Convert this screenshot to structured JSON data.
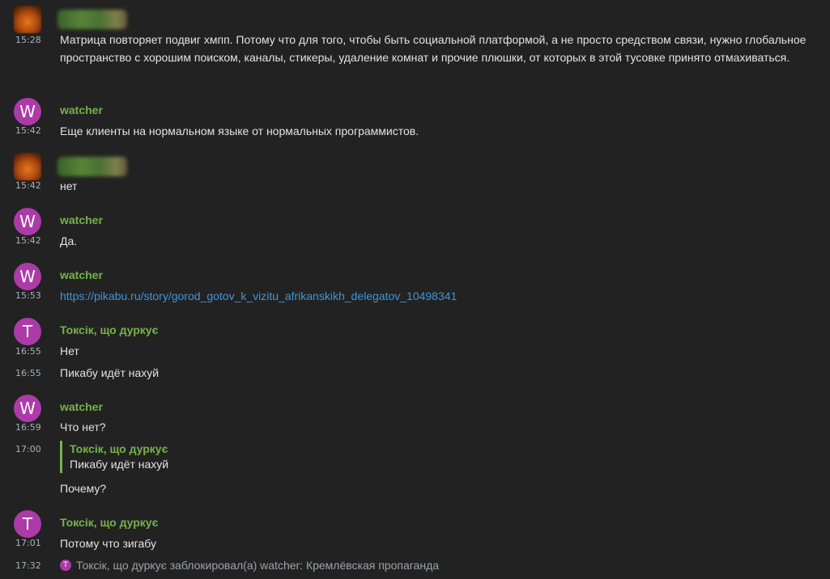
{
  "colors": {
    "background": "#222222",
    "sender_name": "#76b24a",
    "avatar_purple": "#ac3ba8",
    "link": "#3f96d8",
    "text": "#e3e3e3",
    "timestamp": "#a9b1bb"
  },
  "messages": [
    {
      "sender": "",
      "avatar": "blurred-photo",
      "time": "15:28",
      "text": "Матрица повторяет подвиг хмпп. Потому что для того, чтобы быть социальной платформой, а не просто средством связи, нужно глобальное пространство с хорошим поиском, каналы, стикеры, удаление комнат и прочие плюшки, от которых в этой тусовке принято отмахиваться."
    },
    {
      "sender": "watcher",
      "avatar_letter": "W",
      "time": "15:42",
      "text": "Еще клиенты на нормальном языке от нормальных  программистов."
    },
    {
      "sender": "",
      "avatar": "blurred-photo",
      "time": "15:42",
      "text": "нет"
    },
    {
      "sender": "watcher",
      "avatar_letter": "W",
      "time": "15:42",
      "text": "Да."
    },
    {
      "sender": "watcher",
      "avatar_letter": "W",
      "time": "15:53",
      "link": "https://pikabu.ru/story/gorod_gotov_k_vizitu_afrikanskikh_delegatov_10498341"
    },
    {
      "sender": "Токсік, що дуркує",
      "avatar_letter": "T",
      "time": "16:55",
      "text": "Нет"
    },
    {
      "time": "16:55",
      "text": "Пикабу идёт нахуй"
    },
    {
      "sender": "watcher",
      "avatar_letter": "W",
      "time": "16:59",
      "text": "Что нет?"
    },
    {
      "time": "17:00",
      "reply_sender": "Токсік, що дуркує",
      "reply_text": "Пикабу идёт нахуй",
      "text": "Почему?"
    },
    {
      "sender": "Токсік, що дуркує",
      "avatar_letter": "T",
      "time": "17:01",
      "text": "Потому что зигабу"
    }
  ],
  "event": {
    "time": "17:32",
    "avatar_letter": "T",
    "text": "Токсік, що дуркує заблокировал(а) watcher: Кремлёвская пропаганда"
  }
}
